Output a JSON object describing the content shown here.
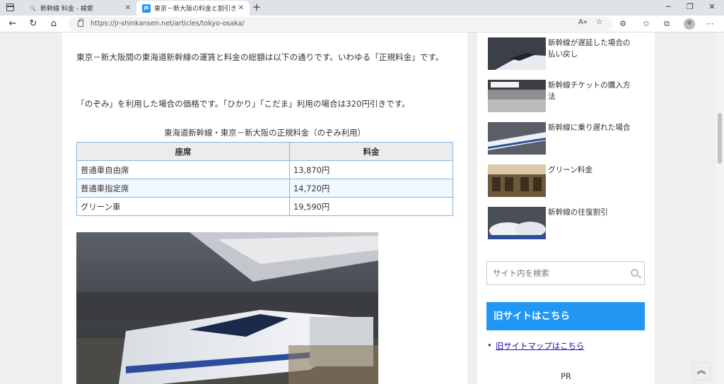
{
  "browser": {
    "tabs": [
      {
        "title": "新幹線 料金 - 検索",
        "active": false,
        "favicon": "search-icon"
      },
      {
        "title": "東京－新大阪の料金と割引きっぷ",
        "active": true,
        "favicon": "JR"
      }
    ],
    "url": "https://jr-shinkansen.net/articles/tokyo-osaka/"
  },
  "article": {
    "para1": "東京－新大阪間の東海道新幹線の運賃と料金の総額は以下の通りです。いわゆる「正規料金」です。",
    "para2": "「のぞみ」を利用した場合の価格です。「ひかり」「こだま」利用の場合は320円引きです。",
    "table_caption": "東海道新幹線・東京－新大阪の正規料金（のぞみ利用）",
    "table": {
      "headers": [
        "座席",
        "料金"
      ],
      "rows": [
        [
          "普通車自由席",
          "13,870円"
        ],
        [
          "普通車指定席",
          "14,720円"
        ],
        [
          "グリーン車",
          "19,590円"
        ]
      ]
    }
  },
  "sidebar": {
    "related": [
      {
        "label": "新幹線が遅延した場合の払い戻し"
      },
      {
        "label": "新幹線チケットの購入方法"
      },
      {
        "label": "新幹線に乗り遅れた場合"
      },
      {
        "label": "グリーン料金"
      },
      {
        "label": "新幹線の往復割引"
      }
    ],
    "search_placeholder": "サイト内を検索",
    "old_site_heading": "旧サイトはこちら",
    "old_site_link": "旧サイトマップはこちら",
    "pr": "PR"
  },
  "colors": {
    "accent": "#2196f3",
    "table_border": "#7fb7e8"
  }
}
